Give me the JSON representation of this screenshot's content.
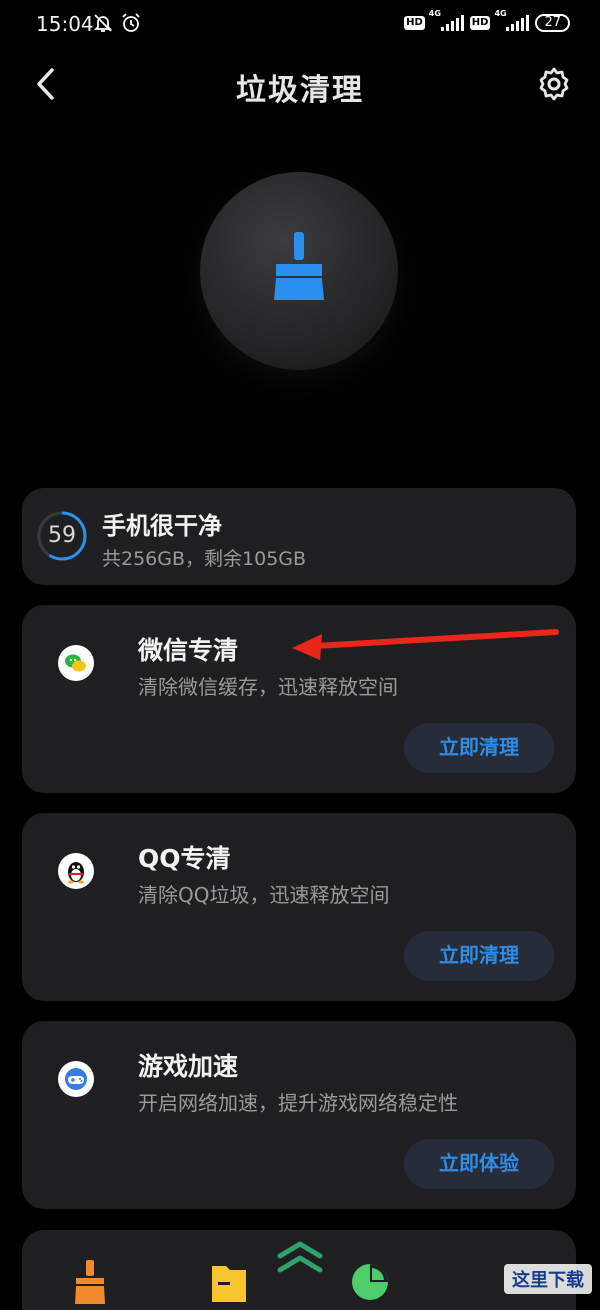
{
  "status_bar": {
    "time": "15:04",
    "network_1": "4G",
    "network_2": "4G",
    "hd_1": "HD",
    "hd_2": "HD",
    "battery": "27"
  },
  "header": {
    "title": "垃圾清理",
    "back_icon": "chevron-left-icon",
    "settings_icon": "gear-icon"
  },
  "hero": {
    "icon": "broom-icon",
    "color": "#2b8ff0"
  },
  "storage": {
    "score": "59",
    "score_fraction": 0.59,
    "title": "手机很干净",
    "subtitle": "共256GB，剩余105GB"
  },
  "features": [
    {
      "title": "微信专清",
      "desc": "清除微信缓存，迅速释放空间",
      "button": "立即清理",
      "icon": "wechat-icon"
    },
    {
      "title": "QQ专清",
      "desc": "清除QQ垃圾，迅速释放空间",
      "button": "立即清理",
      "icon": "qq-penguin-icon"
    },
    {
      "title": "游戏加速",
      "desc": "开启网络加速，提升游戏网络稳定性",
      "button": "立即体验",
      "icon": "gamepad-icon"
    }
  ],
  "bottom_nav": {
    "icons": [
      "broom-icon",
      "folder-icon",
      "double-chevron-up-icon",
      "pie-chart-icon"
    ]
  },
  "watermark": "这里下载",
  "colors": {
    "accent": "#2f8be6",
    "card": "#1f1f21",
    "annotation_arrow": "#e8261c"
  }
}
